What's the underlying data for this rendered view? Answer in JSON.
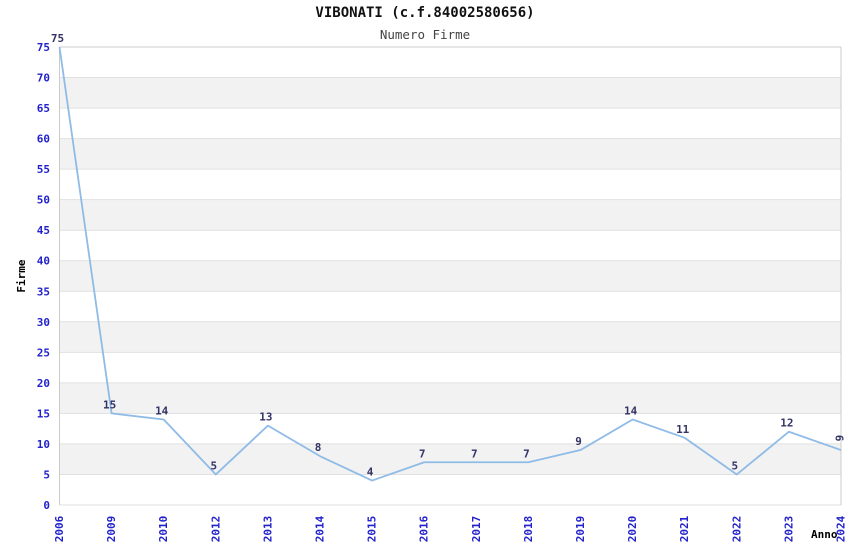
{
  "chart_data": {
    "type": "line",
    "title": "VIBONATI (c.f.84002580656)",
    "subtitle": "Numero Firme",
    "xlabel": "Anno",
    "ylabel": "Firme",
    "x": [
      "2006",
      "2009",
      "2010",
      "2012",
      "2013",
      "2014",
      "2015",
      "2016",
      "2017",
      "2018",
      "2019",
      "2020",
      "2021",
      "2022",
      "2023",
      "2024"
    ],
    "values": [
      75,
      15,
      14,
      5,
      13,
      8,
      4,
      7,
      7,
      7,
      9,
      14,
      11,
      5,
      12,
      9
    ],
    "ylim": [
      0,
      75
    ],
    "ytick_step": 5,
    "grid": true,
    "legend": "none",
    "band_fill": "alternating horizontal stripes between gridlines",
    "point_labels_shown": true,
    "last_point_label_rotated": true,
    "colors": {
      "line": "#8fbbe7",
      "tick_label": "#2222cc",
      "data_label": "#333366",
      "band": "#f2f2f2",
      "gridline": "#e0e0e0",
      "border": "#cccccc",
      "title": "#111111",
      "subtitle": "#444444",
      "axis_title": "#000000",
      "background": "#ffffff"
    }
  }
}
